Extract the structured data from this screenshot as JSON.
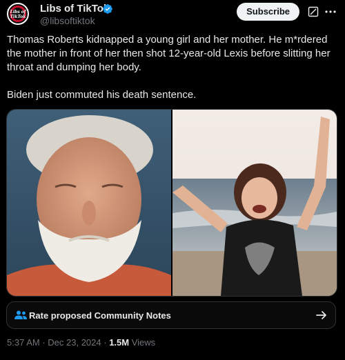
{
  "header": {
    "avatar_text": "Libs of\nTikTok",
    "display_name": "Libs of TikTok",
    "handle": "@libsoftiktok",
    "subscribe_label": "Subscribe"
  },
  "tweet": {
    "text": "Thomas Roberts kidnapped a young girl and her mother. He m*rdered\nthe mother in front of her then shot 12-year-old Lexis before slitting her\nthroat and dumping her body.\n\nBiden just commuted his death sentence."
  },
  "media": {
    "left_image": "mugshot-photo",
    "right_image": "beach-girl-photo"
  },
  "community_notes": {
    "label": "Rate proposed Community Notes"
  },
  "meta": {
    "time": "5:37 AM",
    "date": "Dec 23, 2024",
    "views_count": "1.5M",
    "views_label": "Views"
  },
  "colors": {
    "background": "#000000",
    "text": "#e7e9ea",
    "muted": "#71767b",
    "verified": "#1d9bf0",
    "community_notes": "#1d9bf0"
  }
}
